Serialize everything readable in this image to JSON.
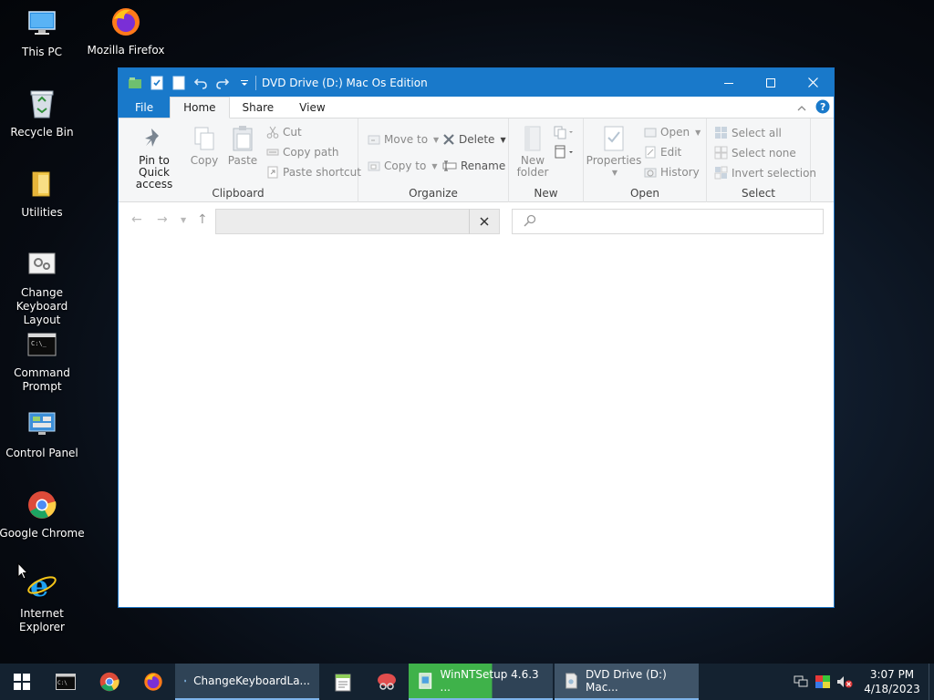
{
  "desktop": {
    "icons": [
      {
        "label": "This PC"
      },
      {
        "label": "Mozilla Firefox"
      },
      {
        "label": "Recycle Bin"
      },
      {
        "label": "Utilities"
      },
      {
        "label": "Change Keyboard Layout"
      },
      {
        "label": "Command Prompt"
      },
      {
        "label": "Control Panel"
      },
      {
        "label": "Google Chrome"
      },
      {
        "label": "Internet Explorer"
      }
    ]
  },
  "window": {
    "title": "DVD Drive (D:) Mac Os Edition",
    "tabs": {
      "file": "File",
      "home": "Home",
      "share": "Share",
      "view": "View"
    },
    "ribbon": {
      "clipboard": {
        "label": "Clipboard",
        "pin": "Pin to Quick access",
        "copy": "Copy",
        "paste": "Paste",
        "cut": "Cut",
        "copy_path": "Copy path",
        "paste_shortcut": "Paste shortcut"
      },
      "organize": {
        "label": "Organize",
        "move_to": "Move to",
        "copy_to": "Copy to",
        "delete": "Delete",
        "rename": "Rename"
      },
      "new": {
        "label": "New",
        "new_folder": "New folder"
      },
      "open": {
        "label": "Open",
        "properties": "Properties",
        "open": "Open",
        "edit": "Edit",
        "history": "History"
      },
      "select": {
        "label": "Select",
        "select_all": "Select all",
        "select_none": "Select none",
        "invert": "Invert selection"
      }
    },
    "address": {
      "value": ""
    },
    "search": {
      "placeholder": ""
    }
  },
  "taskbar": {
    "apps": [
      {
        "label": "ChangeKeyboardLa..."
      },
      {
        "label": "WinNTSetup 4.6.3   ..."
      },
      {
        "label": "DVD Drive (D:) Mac..."
      }
    ],
    "clock": {
      "time": "3:07 PM",
      "date": "4/18/2023"
    }
  },
  "colors": {
    "accent": "#1979ca",
    "taskbar": "#142230",
    "progress": "#3fb24a"
  }
}
